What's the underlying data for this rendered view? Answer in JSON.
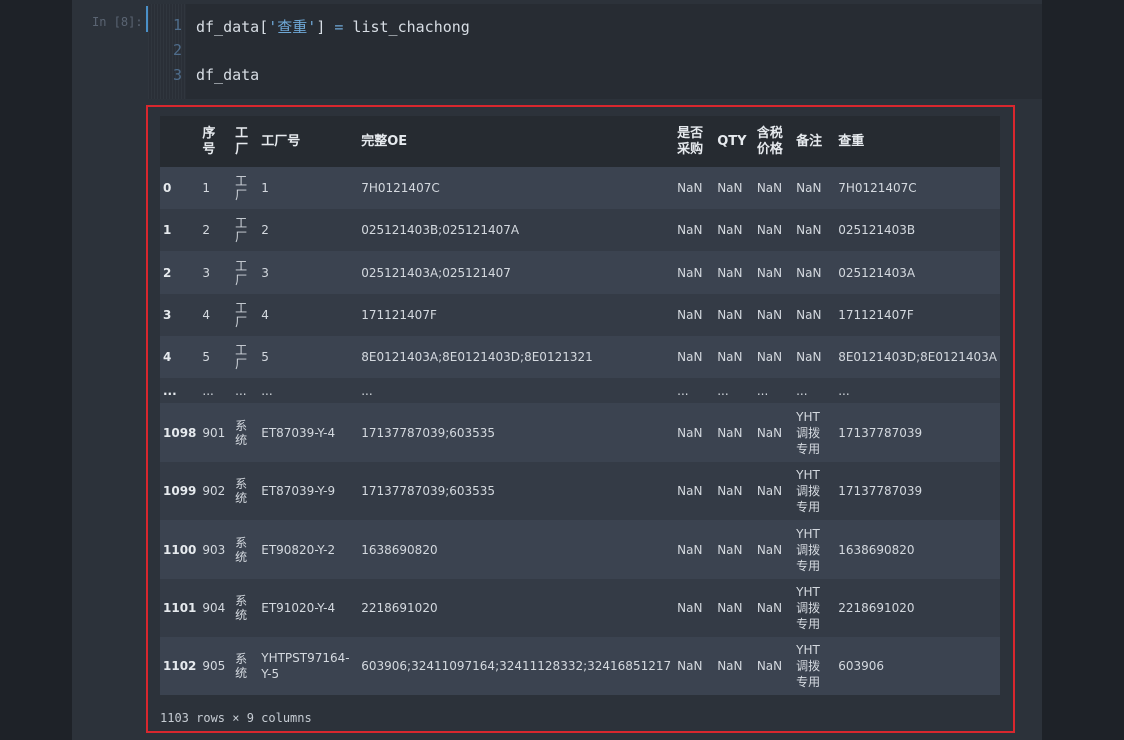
{
  "cell": {
    "prompt": "In [8]:",
    "lines": [
      {
        "no": "1",
        "pre": "df_data[",
        "str": "'查重'",
        "post": "] ",
        "op": "=",
        "rest": " list_chachong"
      },
      {
        "no": "2"
      },
      {
        "no": "3",
        "pre": "df_data"
      }
    ]
  },
  "table": {
    "headers": [
      "",
      "序号",
      "工厂",
      "工厂号",
      "完整OE",
      "是否采购",
      "QTY",
      "含税价格",
      "备注",
      "查重"
    ],
    "rows": [
      [
        "0",
        "1",
        "工厂",
        "1",
        "7H0121407C",
        "NaN",
        "NaN",
        "NaN",
        "NaN",
        "7H0121407C"
      ],
      [
        "1",
        "2",
        "工厂",
        "2",
        "025121403B;025121407A",
        "NaN",
        "NaN",
        "NaN",
        "NaN",
        "025121403B"
      ],
      [
        "2",
        "3",
        "工厂",
        "3",
        "025121403A;025121407",
        "NaN",
        "NaN",
        "NaN",
        "NaN",
        "025121403A"
      ],
      [
        "3",
        "4",
        "工厂",
        "4",
        "171121407F",
        "NaN",
        "NaN",
        "NaN",
        "NaN",
        "171121407F"
      ],
      [
        "4",
        "5",
        "工厂",
        "5",
        "8E0121403A;8E0121403D;8E0121321",
        "NaN",
        "NaN",
        "NaN",
        "NaN",
        "8E0121403D;8E0121403A"
      ],
      [
        "...",
        "...",
        "...",
        "...",
        "...",
        "...",
        "...",
        "...",
        "...",
        "..."
      ],
      [
        "1098",
        "901",
        "系统",
        "ET87039-Y-4",
        "17137787039;603535",
        "NaN",
        "NaN",
        "NaN",
        "YHT调拨专用",
        "17137787039"
      ],
      [
        "1099",
        "902",
        "系统",
        "ET87039-Y-9",
        "17137787039;603535",
        "NaN",
        "NaN",
        "NaN",
        "YHT调拨专用",
        "17137787039"
      ],
      [
        "1100",
        "903",
        "系统",
        "ET90820-Y-2",
        "1638690820",
        "NaN",
        "NaN",
        "NaN",
        "YHT调拨专用",
        "1638690820"
      ],
      [
        "1101",
        "904",
        "系统",
        "ET91020-Y-4",
        "2218691020",
        "NaN",
        "NaN",
        "NaN",
        "YHT调拨专用",
        "2218691020"
      ],
      [
        "1102",
        "905",
        "系统",
        "YHTPST97164-Y-5",
        "603906;32411097164;32411128332;32416851217",
        "NaN",
        "NaN",
        "NaN",
        "YHT调拨专用",
        "603906"
      ]
    ],
    "footer": "1103 rows × 9 columns"
  }
}
